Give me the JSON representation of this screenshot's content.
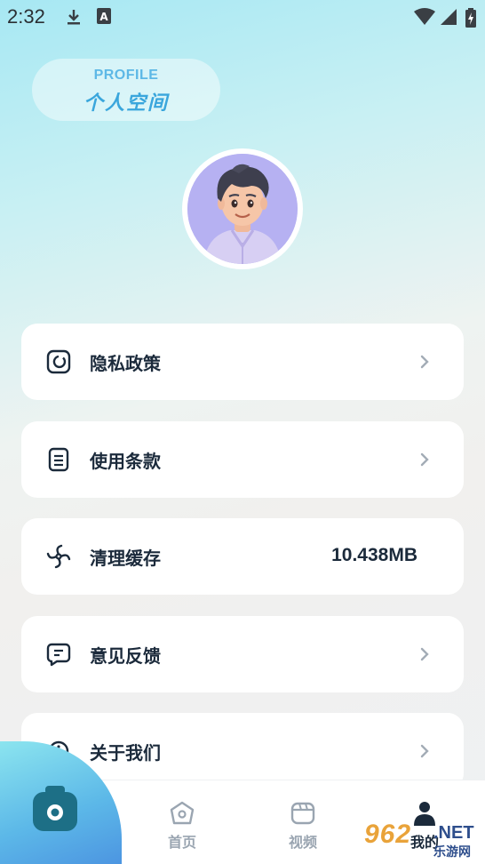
{
  "status_bar": {
    "time": "2:32",
    "icons": [
      "download-icon",
      "a-badge-icon",
      "wifi-icon",
      "signal-icon",
      "battery-icon"
    ]
  },
  "profile": {
    "label_en": "PROFILE",
    "label_cn": "个人空间"
  },
  "avatar": {
    "icon": "avatar-character"
  },
  "menu": {
    "items": [
      {
        "label": "隐私政策",
        "icon": "privacy-icon",
        "value": ""
      },
      {
        "label": "使用条款",
        "icon": "terms-icon",
        "value": ""
      },
      {
        "label": "清理缓存",
        "icon": "clear-cache-icon",
        "value": "10.438MB"
      },
      {
        "label": "意见反馈",
        "icon": "feedback-icon",
        "value": ""
      },
      {
        "label": "关于我们",
        "icon": "about-icon",
        "value": ""
      }
    ]
  },
  "bottom_nav": {
    "items": [
      {
        "label": "首页",
        "icon": "home-icon"
      },
      {
        "label": "视频",
        "icon": "video-icon"
      },
      {
        "label": "我的",
        "icon": "profile-icon"
      }
    ]
  },
  "fab": {
    "icon": "camera-icon"
  },
  "watermark": {
    "num": "962",
    "net": ".NET",
    "cn": "乐游网"
  },
  "colors": {
    "accent": "#3aa6dc",
    "fab_gradient_start": "#8de6ef",
    "fab_gradient_end": "#4a90e0",
    "text_primary": "#1b2a3b",
    "nav_inactive": "#9aa5b1"
  }
}
